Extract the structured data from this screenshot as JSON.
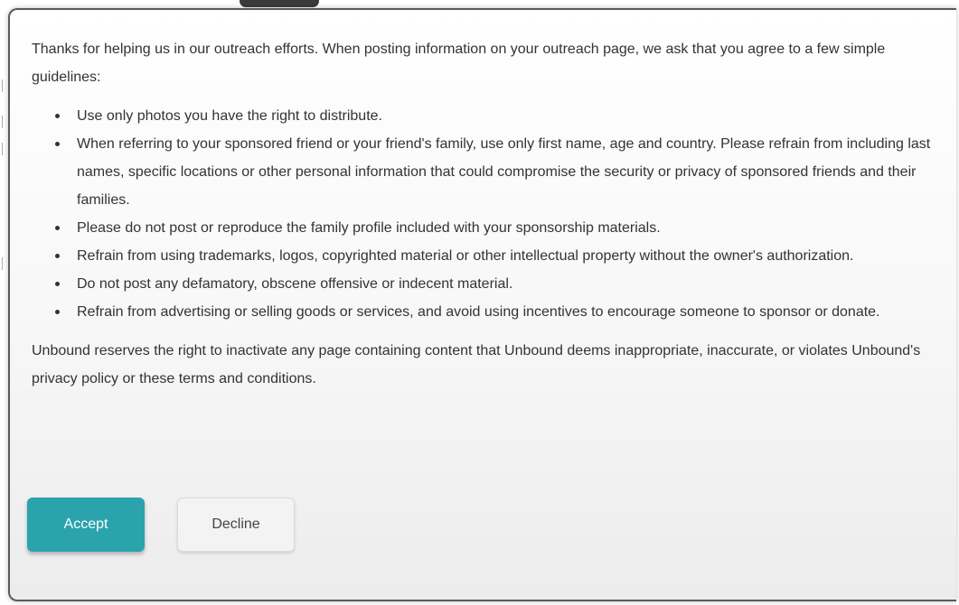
{
  "modal": {
    "intro": "Thanks for helping us in our outreach efforts. When posting information on your outreach page, we ask that you agree to a few simple guidelines:",
    "guidelines": [
      "Use only photos you have the right to distribute.",
      "When referring to your sponsored friend or your friend's family, use only first name, age and country. Please refrain from including last names, specific locations or other personal information that could compromise the security or privacy of sponsored friends and their families.",
      "Please do not post or reproduce the family profile included with your sponsorship materials.",
      "Refrain from using trademarks, logos, copyrighted material or other intellectual property without the owner's authorization.",
      "Do not post any defamatory, obscene offensive or indecent material.",
      "Refrain from advertising or selling goods or services, and avoid using incentives to encourage someone to sponsor or donate."
    ],
    "closing": "Unbound reserves the right to inactivate any page containing content that Unbound deems inappropriate, inaccurate, or violates Unbound's privacy policy or these terms and conditions.",
    "accept_label": "Accept",
    "decline_label": "Decline"
  },
  "colors": {
    "accent": "#2aa3ad",
    "text": "#333333",
    "decline_bg": "#f3f3f3"
  }
}
